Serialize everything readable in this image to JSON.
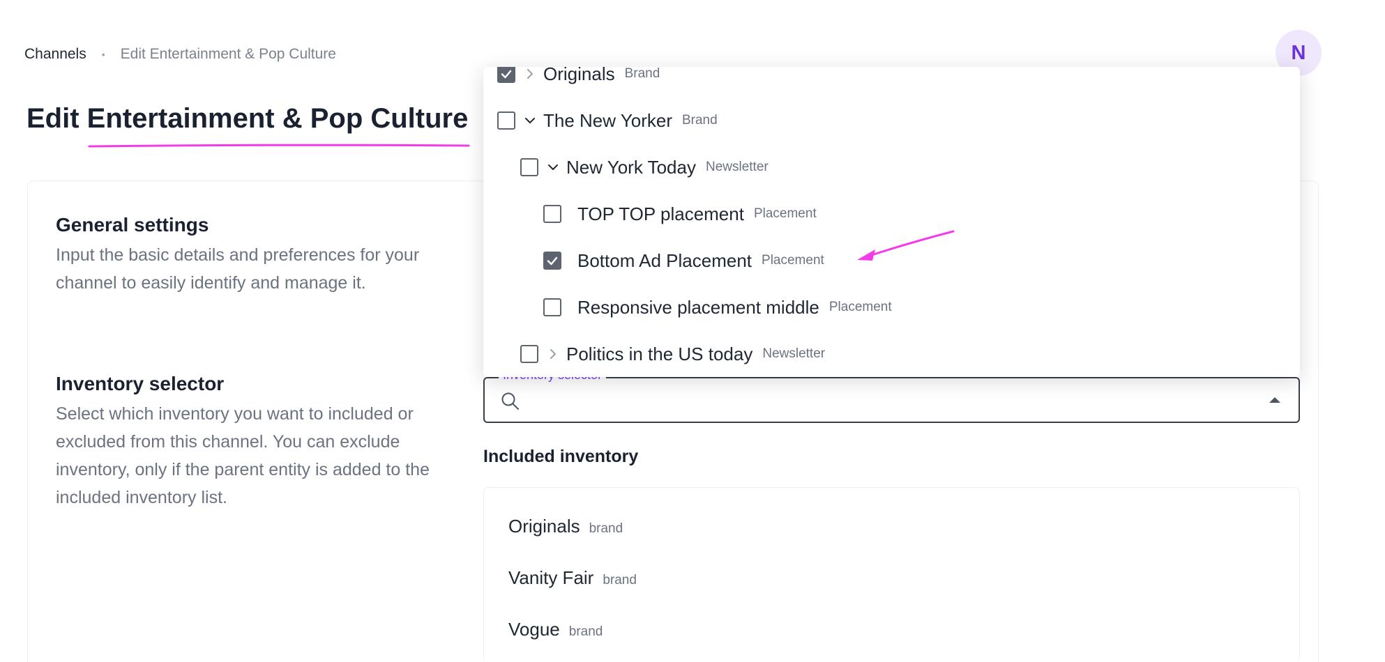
{
  "breadcrumb": {
    "root": "Channels",
    "separator": "•",
    "current": "Edit Entertainment & Pop Culture"
  },
  "avatar": {
    "initial": "N"
  },
  "page": {
    "title": "Edit Entertainment & Pop Culture"
  },
  "general": {
    "title": "General settings",
    "description": "Input the basic details and preferences for your channel to easily identify and manage it."
  },
  "inventory": {
    "title": "Inventory selector",
    "description": "Select which inventory you want to included or excluded from this channel. You can exclude inventory, only if the parent entity is added to the included inventory list.",
    "field_label": "Inventory selector",
    "included_label": "Included inventory"
  },
  "dropdown": {
    "items": [
      {
        "name": "Originals",
        "type": "Brand",
        "checked": true,
        "expanded": false,
        "level": 0
      },
      {
        "name": "The New Yorker",
        "type": "Brand",
        "checked": false,
        "expanded": true,
        "level": 0
      },
      {
        "name": "New York Today",
        "type": "Newsletter",
        "checked": false,
        "expanded": true,
        "level": 1
      },
      {
        "name": "TOP TOP placement",
        "type": "Placement",
        "checked": false,
        "level": 2
      },
      {
        "name": "Bottom Ad Placement",
        "type": "Placement",
        "checked": true,
        "level": 2
      },
      {
        "name": "Responsive placement middle",
        "type": "Placement",
        "checked": false,
        "level": 2
      },
      {
        "name": "Politics in the US today",
        "type": "Newsletter",
        "checked": false,
        "expanded": false,
        "level": 1
      }
    ]
  },
  "included": {
    "items": [
      {
        "name": "Originals",
        "type": "brand"
      },
      {
        "name": "Vanity Fair",
        "type": "brand"
      },
      {
        "name": "Vogue",
        "type": "brand"
      }
    ]
  },
  "colors": {
    "accent": "#7c3aed",
    "annotation": "#f23ce8",
    "avatar_bg": "#efe7fb"
  },
  "icons": {
    "search": "search-icon",
    "caret": "caret-up-icon",
    "chevron_right": "chevron-right-icon",
    "chevron_down": "chevron-down-icon",
    "check": "check-icon"
  }
}
